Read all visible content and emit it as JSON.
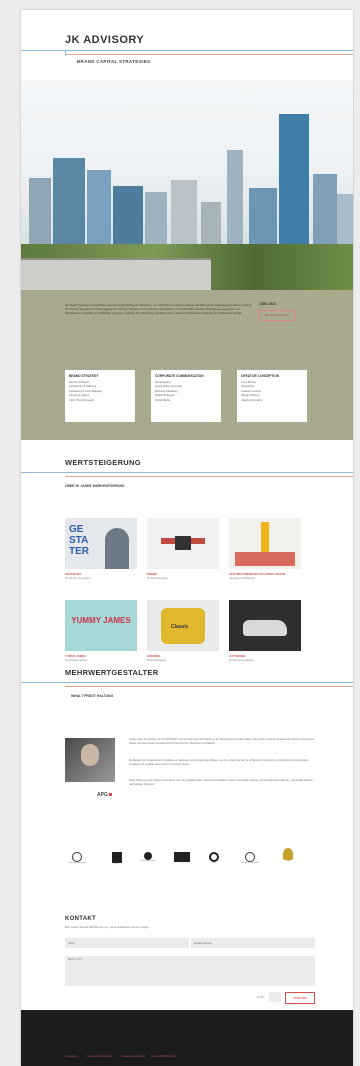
{
  "brand": {
    "name": "JK ADVISORY",
    "tagline": "BRAND CAPITAL STRATEGIES"
  },
  "intro": {
    "text": "Die Begriff \"Advisory\" ist begrifflich in der Praxis gleichwertig mit \"Beratung\" - ein Unternehmen berät ein anderes. Mit Blick auf die Gestaltung von Marken umfasst JK Advisory das gesamte Leistungsspektrum zwischen Strategie, Kommunikation und Kreation. Als Schnittstelle zwischen Unternehmen, Agenturen und Dienstleistern entwickeln wir individuelle Lösungen, begleiten die Umsetzung und stellen sicher, dass jede Maßnahme langfristig zum Markenwert beiträgt.",
    "side_label": "JOBS 2022",
    "side_button": "JETZT ANFRAGE"
  },
  "cards": [
    {
      "title": "BRAND STRATEGY",
      "items": [
        "Identity & Mission",
        "Architecture & Planning",
        "Positioning & Core Message",
        "Naming & Claims",
        "CEO / Brand Strength"
      ]
    },
    {
      "title": "CORPORATE COMMUNICATION",
      "items": [
        "Campaigning",
        "Sustainability Overview",
        "Business Marketing",
        "Digital Strategies",
        "Social Media"
      ]
    },
    {
      "title": "CREATIVE CONCEPTION",
      "items": [
        "Copy Writing",
        "Storytelling",
        "Creative Concept",
        "Design Thinking",
        "Graphic Recording"
      ]
    }
  ],
  "wert": {
    "title": "WERTSTEIGERUNG",
    "subtitle": "ÜBER 30 JAHRE MARKENFÜHRUNG"
  },
  "projects": [
    {
      "thumb_text": "GE STA TER",
      "caption": "GESTARTET",
      "desc": "JK Advisory Kampagne"
    },
    {
      "thumb_text": "",
      "caption": "DRONE",
      "desc": "Produkt Kampagne"
    },
    {
      "thumb_text": "",
      "caption": "STIFTWETTBEWERB FÜR JUNGE GRAFIK",
      "desc": "Kampagne Wettbewerb"
    },
    {
      "thumb_text": "YUMMY JAMES",
      "caption": "YUMMY JAMES",
      "desc": "Food Markenaufbau"
    },
    {
      "thumb_text": "Classic",
      "caption": "GRUNDEL",
      "desc": "Brand Packaging"
    },
    {
      "thumb_text": "",
      "caption": "AUTOMOBIL",
      "desc": "Brand Kommunikation"
    }
  ],
  "mehr": {
    "title": "MEHRWERTGESTALTER",
    "subtitle": "INHALT PRÄGT HALTUNG",
    "logo_label": "APG",
    "paragraphs": [
      "Jochen Kleis ist Gründer von JK ADVISORY und seit über drei Jahrzehnten in der Markenkommunikation tätig. Seine Arbeit verbindet strategische Klarheit mit kreativer Stärke und einem tiefen Verständnis für Unternehmen, Menschen und Märkte.",
      "Als Berater und Kreativdirektor begleitete er nationale und internationale Marken von der ersten Idee bis zur erfolgreichen Umsetzung. Zahlreiche Auszeichnungen bestätigen die Qualität seiner Arbeit und seines Teams.",
      "Seine Haltung ist klar: Marken sind Werte, die man gestalten kann. Gute Kommunikation entsteht aus Inhalt, Haltung und konsequenter Führung - und schafft dadurch nachhaltigen Mehrwert."
    ]
  },
  "awards": [
    {
      "caption": "red dot design award"
    },
    {
      "caption": "ADC"
    },
    {
      "caption": "iF design award"
    },
    {
      "caption": "iF"
    },
    {
      "caption": "Effie"
    },
    {
      "caption": "red dot award 2016"
    },
    {
      "caption": "Gold"
    }
  ],
  "contact": {
    "title": "KONTAKT",
    "lead": "Bitte senden Sie Ihre Nachricht an uns - gerne beantworten wir Ihre Fragen.",
    "name_placeholder": "Name",
    "email_placeholder": "E-Mail-Adresse",
    "message_placeholder": "Nachricht",
    "captcha_label": "Ich bin",
    "submit": "Absenden"
  },
  "footer": {
    "links": [
      "Impressum",
      "Datenschutzerklärung",
      "Cookie-Einstellungen",
      "Cookie-Richtlinie (EU)"
    ]
  },
  "colors": {
    "accent": "#d2504c",
    "olive": "#a9a98e",
    "footer": "#1c1c1c"
  }
}
